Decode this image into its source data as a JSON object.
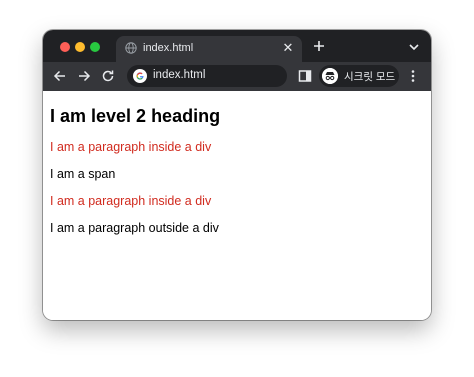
{
  "browser": {
    "tab": {
      "title": "index.html",
      "favicon": "globe-icon"
    },
    "omnibox": {
      "text": "index.html",
      "site_icon": "google-g-icon"
    },
    "profile": {
      "label": "시크릿 모드",
      "icon": "incognito-icon"
    },
    "toolbar_icons": [
      "back-arrow-icon",
      "forward-arrow-icon",
      "reload-icon",
      "side-panel-icon",
      "more-menu-icon"
    ],
    "tabstrip_icons": [
      "close-icon",
      "new-tab-plus-icon",
      "tab-search-chevron-icon"
    ]
  },
  "page": {
    "heading": "I am level 2 heading",
    "div1_paragraph": "I am a paragraph inside a div",
    "span_text": "I am a span",
    "div2_paragraph": "I am a paragraph inside a div",
    "outside_paragraph": "I am a paragraph outside a div"
  },
  "colors": {
    "tabstrip_bg": "#202124",
    "toolbar_bg": "#35363a",
    "paragraph_red": "#d12b1f",
    "close_dot": "#ff5f57",
    "minimize_dot": "#febc2e",
    "zoom_dot": "#28c840"
  }
}
